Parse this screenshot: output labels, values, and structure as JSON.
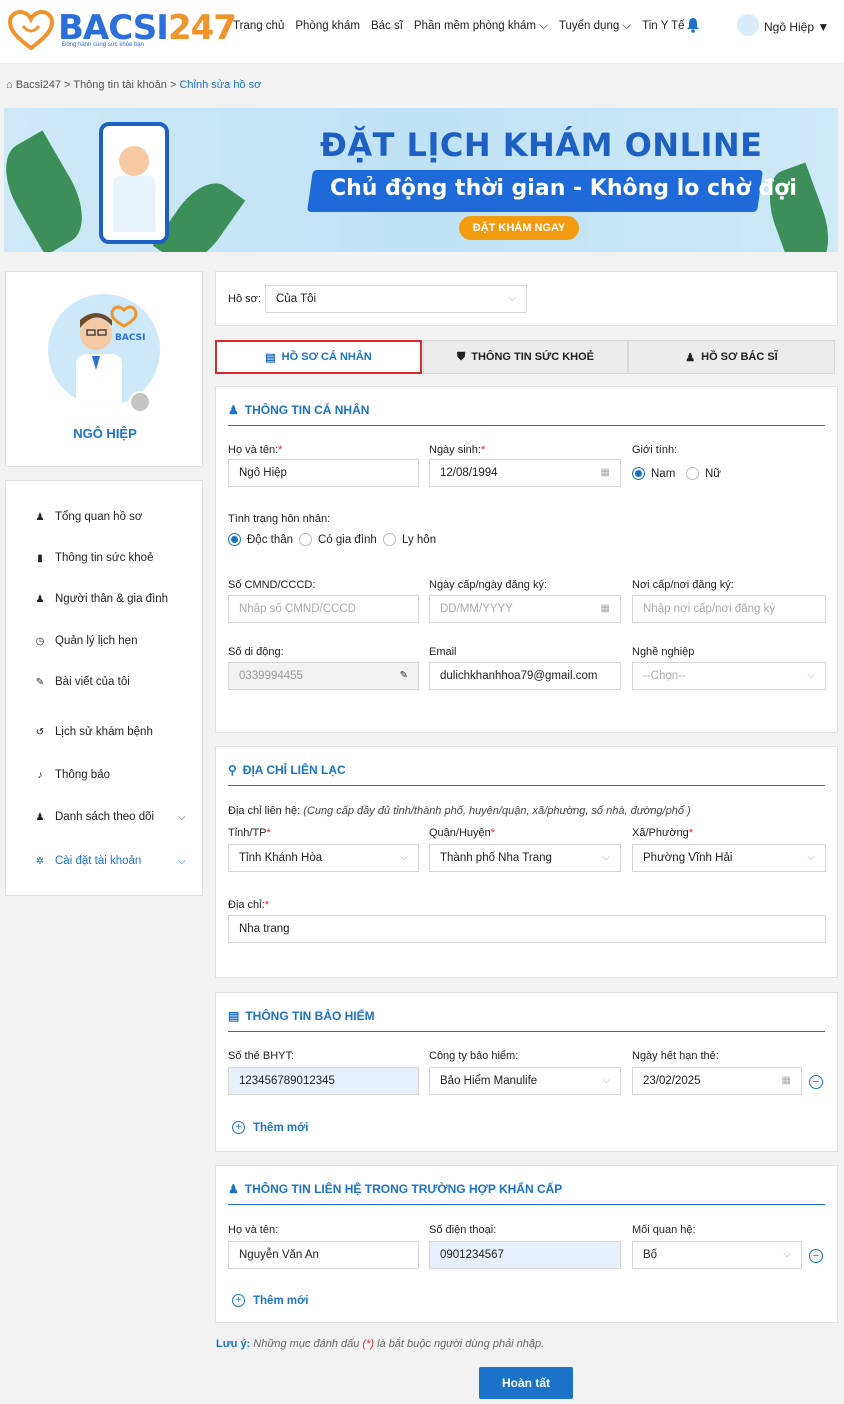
{
  "header": {
    "logo_main": "BACSI",
    "logo_num": "247",
    "logo_sub": "Đồng hành cùng sức khỏe bạn",
    "nav": [
      "Trang chủ",
      "Phòng khám",
      "Bác sĩ",
      "Phần mềm phòng khám ⌵",
      "Tuyển dụng ⌵",
      "Tin Y Tế"
    ],
    "user_name": "Ngô Hiệp ▼"
  },
  "breadcrumb": {
    "home": "Bacsi247",
    "sep": ">",
    "account": "Thông tin tài khoản",
    "current": "Chỉnh sửa hồ sơ"
  },
  "banner": {
    "title": "ĐẶT LỊCH KHÁM ONLINE",
    "subtitle": "Chủ động thời gian - Không lo chờ đợi",
    "button": "ĐẶT KHÁM NGAY"
  },
  "profile": {
    "name": "NGÔ HIỆP"
  },
  "menu": [
    {
      "label": "Tổng quan hồ sơ",
      "icon": "user-icon",
      "glyph": "♟"
    },
    {
      "label": "Thông tin sức khoẻ",
      "icon": "book-icon",
      "glyph": "▮"
    },
    {
      "label": "Người thân & gia đình",
      "icon": "family-icon",
      "glyph": "♟"
    },
    {
      "label": "Quản lý lịch hẹn",
      "icon": "clock-icon",
      "glyph": "◷"
    },
    {
      "label": "Bài viết của tôi",
      "icon": "pin-icon",
      "glyph": "✎"
    },
    {
      "label": "Lịch sử khám bệnh",
      "icon": "history-icon",
      "glyph": "↺"
    },
    {
      "label": "Thông báo",
      "icon": "bell-icon",
      "glyph": "♪"
    },
    {
      "label": "Danh sách theo dõi",
      "icon": "follow-icon",
      "glyph": "♟"
    },
    {
      "label": "Cài đặt tài khoản",
      "icon": "gear-icon",
      "glyph": "✲"
    }
  ],
  "hoso": {
    "label": "Hồ sơ:",
    "value": "Của Tôi"
  },
  "tabs": [
    "HỒ SƠ CÁ NHÂN",
    "THÔNG TIN SỨC KHOẺ",
    "HỒ SƠ BÁC SĨ"
  ],
  "personal": {
    "title": "THÔNG TIN CÁ NHÂN",
    "name_label": "Họ và tên:",
    "name_value": "Ngô Hiệp",
    "dob_label": "Ngày sinh:",
    "dob_value": "12/08/1994",
    "gender_label": "Giới tính:",
    "gender_male": "Nam",
    "gender_female": "Nữ",
    "marital_label": "Tình trạng hôn nhân:",
    "marital_single": "Độc thân",
    "marital_married": "Có gia đình",
    "marital_divorced": "Ly hôn",
    "id_label": "Số CMND/CCCD:",
    "id_placeholder": "Nhập số CMND/CCCD",
    "issue_date_label": "Ngày cấp/ngày đăng ký:",
    "issue_date_placeholder": "DD/MM/YYYY",
    "issue_place_label": "Nơi cấp/nơi đăng ký:",
    "issue_place_placeholder": "Nhập nơi cấp/nơi đăng ký",
    "phone_label": "Số di động:",
    "phone_value": "0339994455",
    "email_label": "Email",
    "email_value": "dulichkhanhhoa79@gmail.com",
    "job_label": "Nghề nghiệp",
    "job_placeholder": "--Chọn--"
  },
  "address": {
    "title": "ĐỊA CHỈ LIÊN LẠC",
    "contact_label": "Địa chỉ liên hệ:",
    "contact_hint": "(Cung cấp đầy đủ tỉnh/thành phố, huyện/quận, xã/phường, số nhà, đường/phố )",
    "province_label": "Tỉnh/TP",
    "province_value": "Tỉnh Khánh Hòa",
    "district_label": "Quận/Huyện",
    "district_value": "Thành phố Nha Trang",
    "ward_label": "Xã/Phường",
    "ward_value": "Phường Vĩnh Hải",
    "addr_label": "Địa chỉ:",
    "addr_value": "Nha trang"
  },
  "insurance": {
    "title": "THÔNG TIN BẢO HIỂM",
    "card_label": "Số thẻ BHYT:",
    "card_value": "123456789012345",
    "company_label": "Công ty bảo hiểm:",
    "company_value": "Bảo Hiểm Manulife",
    "expiry_label": "Ngày hết hạn thẻ:",
    "expiry_value": "23/02/2025",
    "add_label": "Thêm mới"
  },
  "emergency": {
    "title": "THÔNG TIN LIÊN HỆ TRONG TRƯỜNG HỢP KHẨN CẤP",
    "name_label": "Họ và tên:",
    "name_value": "Nguyễn Văn An",
    "phone_label": "Số điện thoại:",
    "phone_value": "0901234567",
    "relation_label": "Mối quan hệ:",
    "relation_value": "Bố",
    "add_label": "Thêm mới"
  },
  "note": {
    "prefix": "Lưu ý:",
    "text_a": " Những mục đánh dấu ",
    "mark": "(*)",
    "text_b": " là bắt buộc người dùng phải nhập."
  },
  "submit": "Hoàn tất",
  "colors": {
    "primary": "#1a73c8",
    "required": "#e0292b",
    "accent": "#f39c12"
  }
}
